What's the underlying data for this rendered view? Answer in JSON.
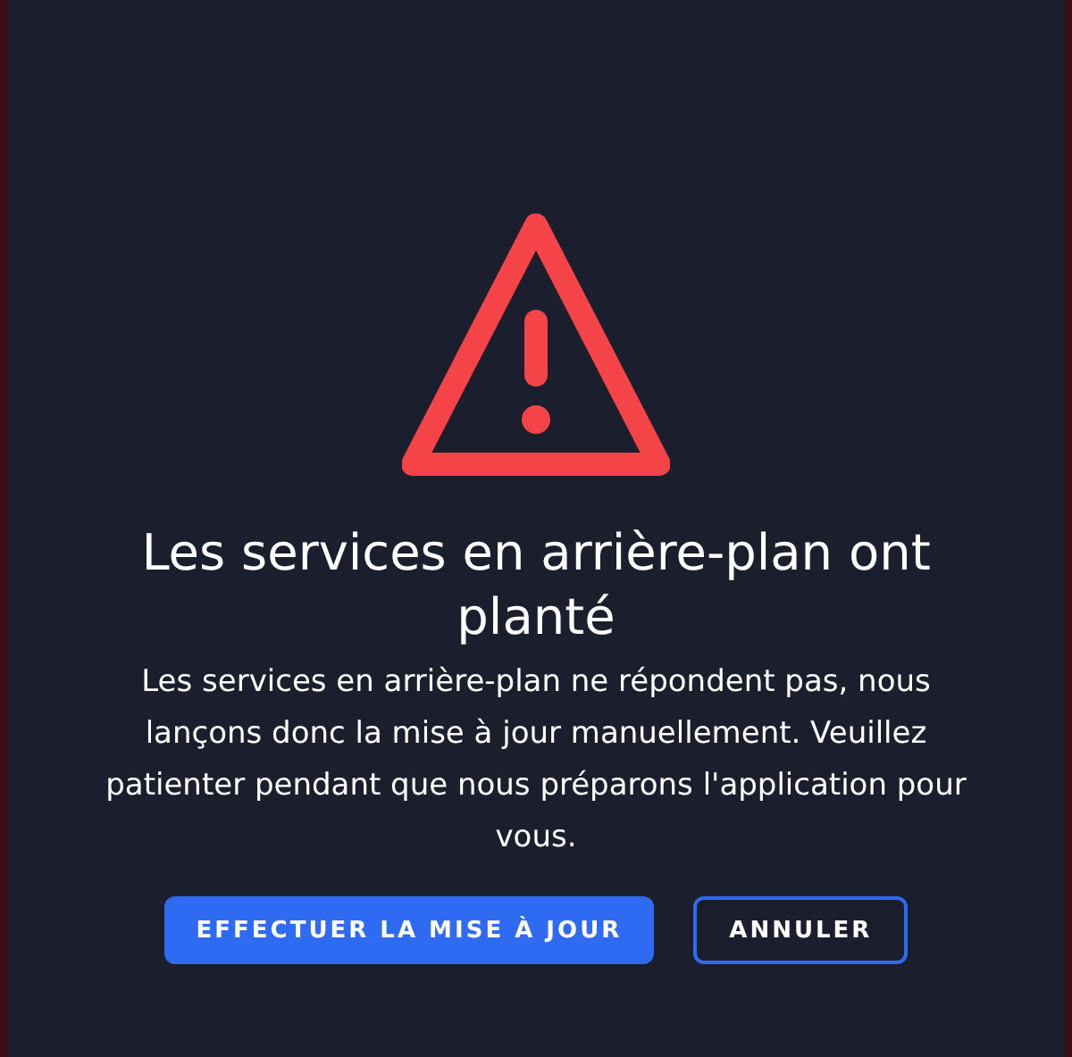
{
  "dialog": {
    "title": "Les services en arrière-plan ont planté",
    "message": "Les services en arrière-plan ne répondent pas, nous lançons donc la mise à jour manuellement. Veuillez patienter pendant que nous préparons l'application pour vous.",
    "buttons": [
      {
        "label": "EFFECTUER LA MISE À JOUR",
        "kind": "primary"
      },
      {
        "label": "ANNULER",
        "kind": "secondary"
      }
    ]
  }
}
